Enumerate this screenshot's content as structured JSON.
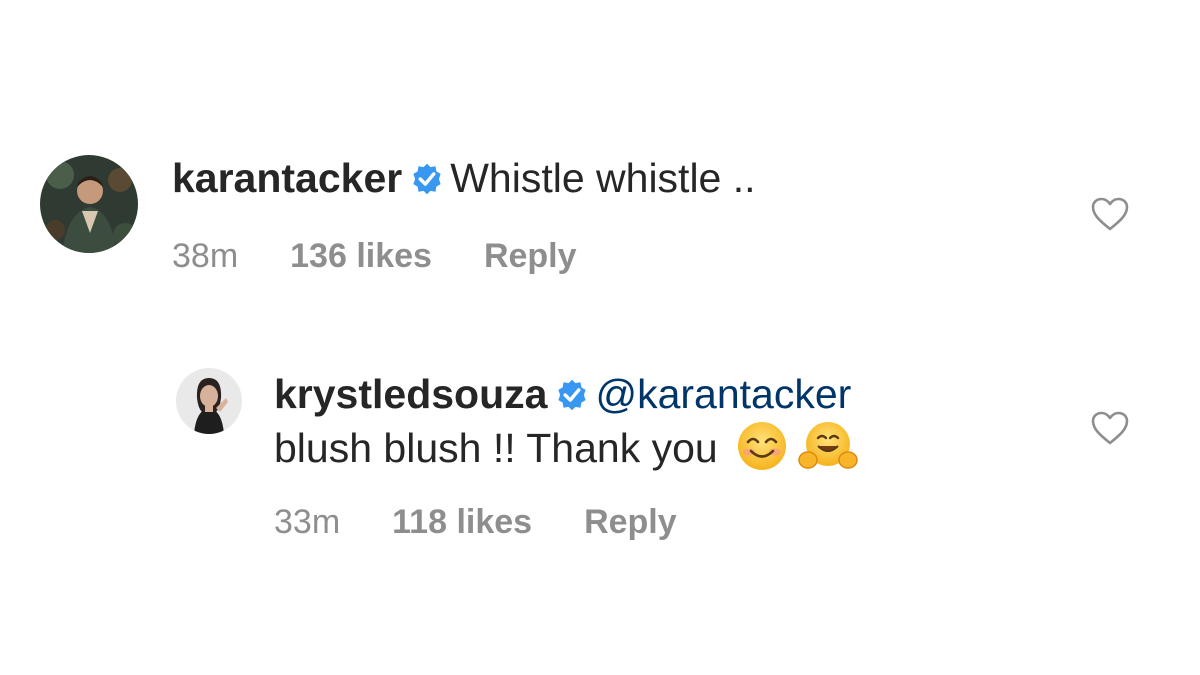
{
  "comments": [
    {
      "username": "karantacker",
      "verified": true,
      "text": "Whistle whistle ..",
      "time": "38m",
      "likes": "136 likes",
      "reply_label": "Reply"
    },
    {
      "username": "krystledsouza",
      "verified": true,
      "mention": "@karantacker",
      "text": "blush blush !! Thank you",
      "emojis": [
        "smiling-face-emoji",
        "hugging-face-emoji"
      ],
      "time": "33m",
      "likes": "118 likes",
      "reply_label": "Reply"
    }
  ],
  "colors": {
    "text": "#262626",
    "meta": "#8e8e8e",
    "mention": "#003569",
    "verified": "#3897f0"
  }
}
